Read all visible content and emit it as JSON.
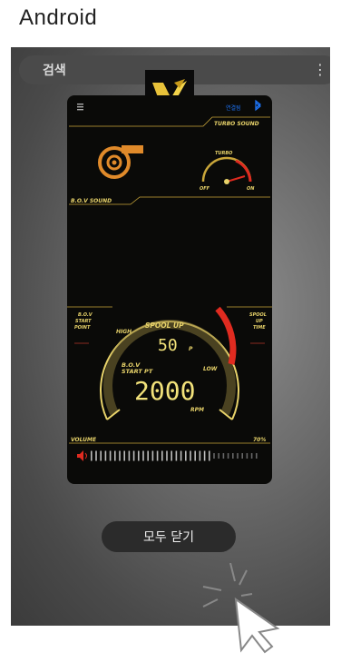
{
  "platform_label": "Android",
  "search": {
    "label": "검색",
    "more_icon": "more-vert-icon"
  },
  "app_card": {
    "connect_label": "연결됨",
    "turbo_sound_label": "TURBO SOUND",
    "turbo_gauge_label": "TURBO",
    "turbo_off_label": "OFF",
    "turbo_on_label": "ON",
    "bov_sound_label": "B.O.V SOUND",
    "bov_start_point_label": [
      "B.O.V",
      "START",
      "POINT"
    ],
    "spool_up_time_label": [
      "SPOOL",
      "UP",
      "TIME"
    ],
    "high_label": "HIGH",
    "low_label": "LOW",
    "spool_up_label": "SPOOL UP",
    "spool_value": "50",
    "spool_unit": "P",
    "bov_start_pt_label": [
      "B.O.V",
      "START PT"
    ],
    "rpm_value": "2000",
    "rpm_unit": "RPM",
    "volume_label": "VOLUME",
    "volume_percent": "70%",
    "volume_level": 0.7
  },
  "close_all_label": "모두 닫기",
  "colors": {
    "accent": "#e8d36a",
    "orange": "#e08a2a",
    "red": "#e02b20",
    "bluetooth": "#1e78ff"
  }
}
